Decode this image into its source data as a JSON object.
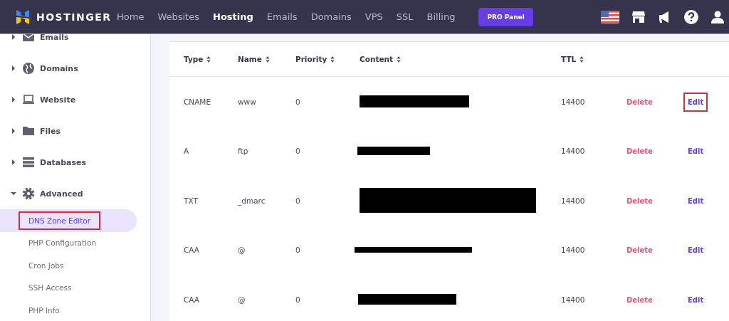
{
  "header": {
    "brand": "HOSTINGER",
    "nav": [
      {
        "label": "Home",
        "selected": false
      },
      {
        "label": "Websites",
        "selected": false
      },
      {
        "label": "Hosting",
        "selected": true
      },
      {
        "label": "Emails",
        "selected": false
      },
      {
        "label": "Domains",
        "selected": false
      },
      {
        "label": "VPS",
        "selected": false
      },
      {
        "label": "SSL",
        "selected": false
      },
      {
        "label": "Billing",
        "selected": false
      }
    ],
    "pro_button": "PRO Panel"
  },
  "sidebar": {
    "items": [
      {
        "label": "Emails",
        "kind": "mail",
        "expanded": false
      },
      {
        "label": "Domains",
        "kind": "globe",
        "expanded": false
      },
      {
        "label": "Website",
        "kind": "laptop",
        "expanded": false
      },
      {
        "label": "Files",
        "kind": "folder",
        "expanded": false
      },
      {
        "label": "Databases",
        "kind": "database",
        "expanded": false
      },
      {
        "label": "Advanced",
        "kind": "gear",
        "expanded": true,
        "children": [
          {
            "label": "DNS Zone Editor",
            "selected": true,
            "highlighted": true
          },
          {
            "label": "PHP Configuration",
            "selected": false,
            "highlighted": false
          },
          {
            "label": "Cron Jobs",
            "selected": false,
            "highlighted": false
          },
          {
            "label": "SSH Access",
            "selected": false,
            "highlighted": false
          },
          {
            "label": "PHP Info",
            "selected": false,
            "highlighted": false
          }
        ]
      }
    ]
  },
  "table": {
    "columns": [
      "Type",
      "Name",
      "Priority",
      "Content",
      "TTL"
    ],
    "rows": [
      {
        "type": "CNAME",
        "name": "www",
        "priority": "0",
        "content_redacted": true,
        "ttl": "14400",
        "delete": "Delete",
        "edit": "Edit",
        "edit_highlighted": true
      },
      {
        "type": "A",
        "name": "ftp",
        "priority": "0",
        "content_redacted": true,
        "ttl": "14400",
        "delete": "Delete",
        "edit": "Edit",
        "edit_highlighted": false
      },
      {
        "type": "TXT",
        "name": "_dmarc",
        "priority": "0",
        "content_redacted": true,
        "ttl": "14400",
        "delete": "Delete",
        "edit": "Edit",
        "edit_highlighted": false
      },
      {
        "type": "CAA",
        "name": "@",
        "priority": "0",
        "content_redacted": true,
        "ttl": "14400",
        "delete": "Delete",
        "edit": "Edit",
        "edit_highlighted": false
      },
      {
        "type": "CAA",
        "name": "@",
        "priority": "0",
        "content_redacted": true,
        "ttl": "14400",
        "delete": "Delete",
        "edit": "Edit",
        "edit_highlighted": false
      }
    ]
  }
}
